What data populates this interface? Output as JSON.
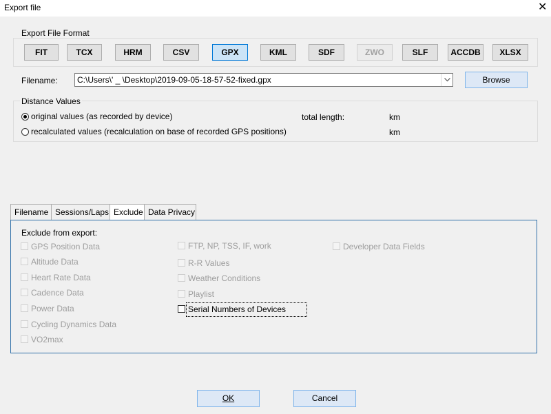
{
  "window": {
    "title": "Export file"
  },
  "export_format": {
    "group_label": "Export File Format",
    "formats": [
      {
        "label": "FIT",
        "state": "normal"
      },
      {
        "label": "TCX",
        "state": "normal"
      },
      {
        "label": "HRM",
        "state": "normal"
      },
      {
        "label": "CSV",
        "state": "normal"
      },
      {
        "label": "GPX",
        "state": "selected"
      },
      {
        "label": "KML",
        "state": "normal"
      },
      {
        "label": "SDF",
        "state": "normal"
      },
      {
        "label": "ZWO",
        "state": "disabled"
      },
      {
        "label": "SLF",
        "state": "normal"
      },
      {
        "label": "ACCDB",
        "state": "normal"
      },
      {
        "label": "XLSX",
        "state": "normal"
      }
    ]
  },
  "filename": {
    "label": "Filename:",
    "value": "C:\\Users\\'  _    \\Desktop\\2019-09-05-18-57-52-fixed.gpx",
    "browse_label": "Browse"
  },
  "distance_values": {
    "group_label": "Distance Values",
    "options": [
      {
        "label": "original values (as recorded by device)",
        "checked": true
      },
      {
        "label": "recalculated values (recalculation on base of recorded GPS positions)",
        "checked": false
      }
    ],
    "total_length_label": "total length:",
    "unit_original": "km",
    "unit_recalculated": "km"
  },
  "tabs": [
    {
      "label": "Filename",
      "active": false
    },
    {
      "label": "Sessions/Laps",
      "active": false
    },
    {
      "label": "Exclude",
      "active": true
    },
    {
      "label": "Data Privacy",
      "active": false
    }
  ],
  "exclude": {
    "heading": "Exclude from export:",
    "col1": [
      "GPS Position Data",
      "Altitude Data",
      "Heart Rate Data",
      "Cadence Data",
      "Power Data",
      "Cycling Dynamics Data",
      "VO2max"
    ],
    "col2": [
      "FTP, NP, TSS, IF, work",
      "R-R Values",
      "Weather Conditions",
      "Playlist",
      "Serial Numbers of Devices"
    ],
    "col3": [
      "Developer Data Fields"
    ]
  },
  "footer": {
    "ok_label": "OK",
    "cancel_label": "Cancel"
  },
  "colors": {
    "selected_format": "#cce4f7",
    "accent_border": "#0078d7",
    "panel_border": "#2f6fa8",
    "dialog_bg": "#f0f0f0"
  }
}
